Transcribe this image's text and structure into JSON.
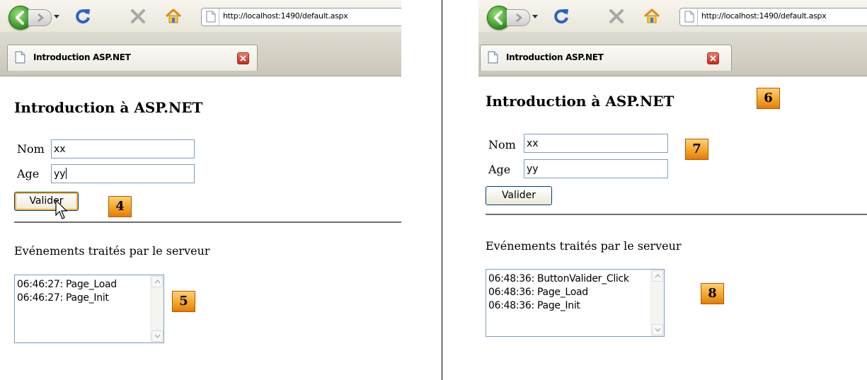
{
  "left": {
    "browser": {
      "url": "http://localhost:1490/default.aspx",
      "tab_title": "Introduction ASP.NET"
    },
    "page": {
      "title": "Introduction à ASP.NET",
      "nom_label": "Nom",
      "nom_value": "xx",
      "age_label": "Age",
      "age_value": "yy",
      "button_label": "Valider",
      "events_label": "Evénements traités par le serveur",
      "events": [
        "06:46:27: Page_Load",
        "06:46:27: Page_Init"
      ]
    },
    "callouts": {
      "button": "4",
      "events": "5"
    }
  },
  "right": {
    "browser": {
      "url": "http://localhost:1490/default.aspx",
      "tab_title": "Introduction ASP.NET"
    },
    "page": {
      "title": "Introduction à ASP.NET",
      "nom_label": "Nom",
      "nom_value": "xx",
      "age_label": "Age",
      "age_value": "yy",
      "button_label": "Valider",
      "events_label": "Evénements traités par le serveur",
      "events": [
        "06:48:36: ButtonValider_Click",
        "06:48:36: Page_Load",
        "06:48:36: Page_Init"
      ]
    },
    "callouts": {
      "title": "6",
      "fields": "7",
      "events": "8"
    }
  },
  "colors": {
    "callout": "#f09a1c",
    "input_border": "#7f9db9",
    "button_border": "#003c74",
    "back_button": "#2f8f1f",
    "tab_close": "#c9281a"
  },
  "icons": [
    "back-icon",
    "forward-icon",
    "dropdown-icon",
    "reload-icon",
    "stop-icon",
    "home-icon",
    "page-icon",
    "close-icon",
    "scroll-up-icon",
    "scroll-down-icon",
    "mouse-pointer-icon"
  ]
}
